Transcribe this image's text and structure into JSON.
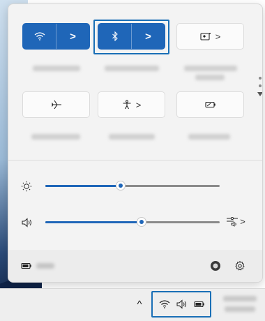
{
  "quick_settings": {
    "tiles": [
      {
        "id": "wifi",
        "icon": "wifi-icon",
        "state": "on",
        "has_chevron": true,
        "chevron": ">"
      },
      {
        "id": "bluetooth",
        "icon": "bluetooth-icon",
        "state": "on",
        "has_chevron": true,
        "chevron": ">"
      },
      {
        "id": "display-cast",
        "icon": "cast-icon",
        "state": "off",
        "has_chevron": true,
        "chevron": ">"
      },
      {
        "id": "airplane",
        "icon": "airplane-icon",
        "state": "off",
        "has_chevron": false
      },
      {
        "id": "accessibility",
        "icon": "accessibility-icon",
        "state": "off",
        "has_chevron": true,
        "chevron": ">"
      },
      {
        "id": "energy",
        "icon": "battery-saver-icon",
        "state": "off",
        "has_chevron": false
      }
    ],
    "brightness": {
      "level": 0.43
    },
    "volume": {
      "level": 0.55,
      "output_chevron": ">"
    },
    "footer": {
      "battery_icon": "battery-icon",
      "settings_icon": "gear-icon"
    }
  },
  "taskbar": {
    "tray_chevron": "^",
    "tray_icons": [
      "wifi-icon",
      "speaker-icon",
      "battery-icon"
    ]
  },
  "colors": {
    "accent": "#1f66b8",
    "highlight": "#1a6fb6"
  }
}
